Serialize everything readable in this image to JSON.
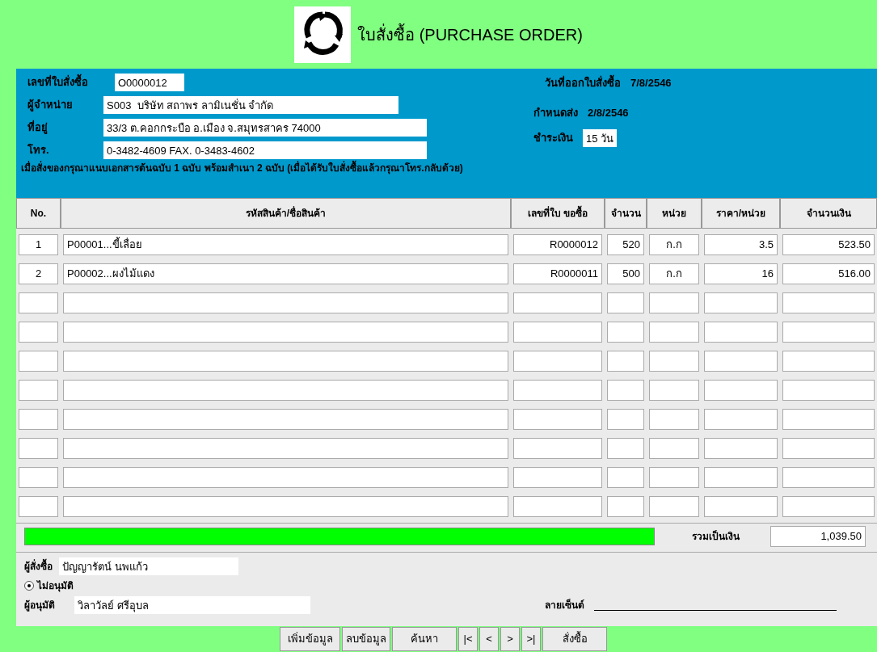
{
  "window": {
    "title": "ใบสั่งซื้อ (PURCHASE ORDER)"
  },
  "header": {
    "po_number_label": "เลขที่ใบสั่งซื้อ",
    "po_number": "O0000012",
    "supplier_label": "ผู้จำหน่าย",
    "supplier": "S003  บริษัท สถาพร ลามิเนชั่น จำกัด",
    "address_label": "ที่อยู่",
    "address": "33/3 ต.คอกกระบือ อ.เมือง จ.สมุทรสาคร 74000",
    "phone_label": "โทร.",
    "phone": "0-3482-4609 FAX. 0-3483-4602",
    "issue_date_label": "วันที่ออกใบสั่งซื้อ",
    "issue_date": "7/8/2546",
    "due_date_label": "กำหนดส่ง",
    "due_date": "2/8/2546",
    "payment_label": "ชำระเงิน",
    "payment": "15 วัน",
    "note": "เมื่อสั่งของกรุณาแนบเอกสารต้นฉบับ 1 ฉบับ พร้อมสำเนา 2 ฉบับ (เมื่อได้รับใบสั่งซื้อแล้วกรุณาโทร.กลับด้วย)"
  },
  "table": {
    "columns": [
      "No.",
      "รหัสสินค้า/ชื่อสินค้า",
      "เลขที่ใบ ขอซื้อ",
      "จำนวน",
      "หน่วย",
      "ราคา/หน่วย",
      "จำนวนเงิน"
    ],
    "rows": [
      [
        "1",
        "P00001...ขี้เลื่อย",
        "R0000012",
        "520",
        "ก.ก",
        "3.5",
        "523.50"
      ],
      [
        "2",
        "P00002...ผงไม้แดง",
        "R0000011",
        "500",
        "ก.ก",
        "16",
        "516.00"
      ]
    ]
  },
  "total_label": "รวมเป็นเงิน",
  "total": "1,039.50",
  "footer": {
    "orderer_label": "ผู้สั่งซื้อ",
    "orderer": "ปัญญารัตน์ นพแก้ว",
    "approval": {
      "label": "ไม่อนุมัติ",
      "selected": true
    },
    "approver_label": "ผู้อนุมัติ",
    "approver": "วิลาวัลย์ ศรีอุบล",
    "signature_label": "ลายเซ็นต์"
  },
  "buttons": [
    "เพิ่มข้อมูล",
    "ลบข้อมูล",
    "ค้นหา",
    "|<",
    "<",
    ">",
    ">|",
    "สั่งซื้อ"
  ]
}
